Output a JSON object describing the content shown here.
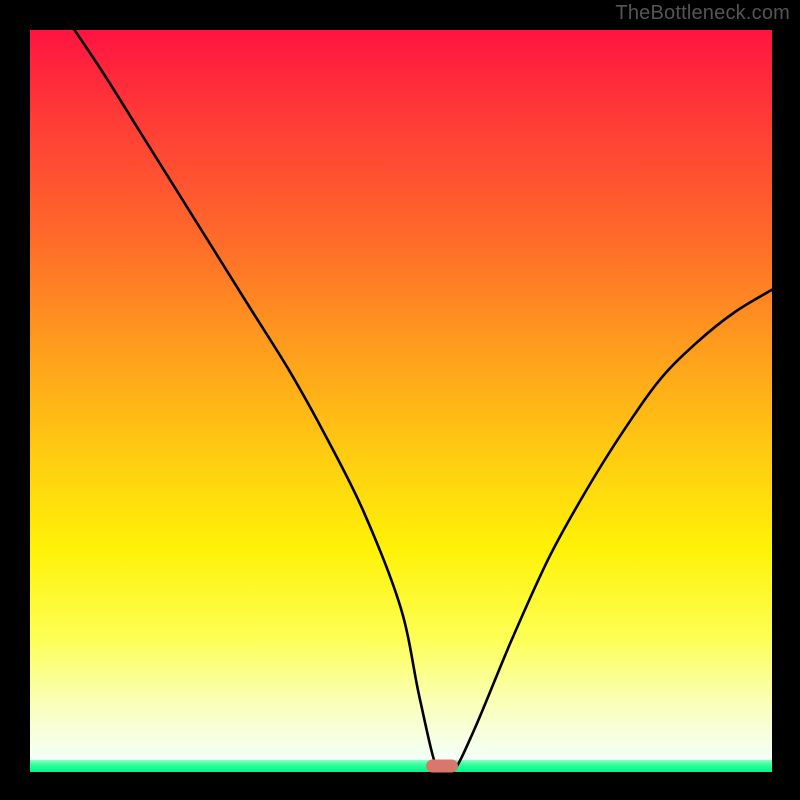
{
  "watermark": "TheBottleneck.com",
  "chart_data": {
    "type": "line",
    "title": "",
    "xlabel": "",
    "ylabel": "",
    "xlim": [
      0,
      100
    ],
    "ylim": [
      0,
      100
    ],
    "grid": false,
    "legend": false,
    "series": [
      {
        "name": "bottleneck-curve",
        "x": [
          6,
          10,
          15,
          20,
          25,
          30,
          35,
          40,
          45,
          50,
          52.5,
          55,
          57,
          60,
          65,
          70,
          75,
          80,
          85,
          90,
          95,
          100
        ],
        "y": [
          100,
          94,
          86,
          78,
          70,
          62,
          54,
          45,
          35,
          22,
          10,
          0,
          0,
          6,
          18,
          29,
          38,
          46,
          53,
          58,
          62,
          65
        ]
      }
    ],
    "marker": {
      "x": 55.5,
      "y": 0.8,
      "color": "#d9776d"
    },
    "gradient_stops": [
      {
        "pos": 0,
        "color": "#ff1440"
      },
      {
        "pos": 0.5,
        "color": "#ffc812"
      },
      {
        "pos": 0.8,
        "color": "#fdff55"
      },
      {
        "pos": 1.0,
        "color": "#00f58a"
      }
    ]
  }
}
